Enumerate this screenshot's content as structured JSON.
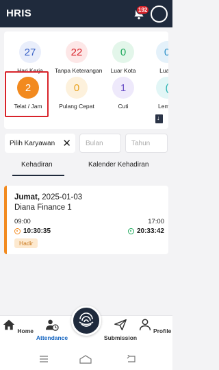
{
  "appbar": {
    "title": "HRIS",
    "notification_count": "192"
  },
  "stats": [
    {
      "value": "27",
      "label": "Hari Kerja",
      "color": "#3a63c7",
      "bg": "#e9eefb"
    },
    {
      "value": "22",
      "label": "Tanpa Keterangan",
      "color": "#d8232a",
      "bg": "#fde7e7"
    },
    {
      "value": "0",
      "label": "Luar Kota",
      "color": "#1ea95c",
      "bg": "#e3f6ea"
    },
    {
      "value": "0",
      "label": "Luar I",
      "color": "#2a8fc7",
      "bg": "#e4f1fa"
    },
    {
      "value": "2",
      "label": "Telat / Jam",
      "color": "#ffffff",
      "bg": "#f28a1f"
    },
    {
      "value": "0",
      "label": "Pulang Cepat",
      "color": "#e8a21f",
      "bg": "#fdf1dc"
    },
    {
      "value": "1",
      "label": "Cuti",
      "color": "#6a4fc7",
      "bg": "#eee9fb"
    },
    {
      "value": "(",
      "label": "Lembu",
      "color": "#2ab0b0",
      "bg": "#e2f6f6"
    }
  ],
  "filters": {
    "employee": "Pilih Karyawan",
    "month_placeholder": "Bulan",
    "year_placeholder": "Tahun"
  },
  "tabs": [
    {
      "label": "Kehadiran",
      "active": true
    },
    {
      "label": "Kalender Kehadiran",
      "active": false
    }
  ],
  "attendance": {
    "day": "Jumat,",
    "date": "2025-01-03",
    "name": "Diana Finance 1",
    "schedule_start": "09:00",
    "schedule_end": "17:00",
    "check_in": "10:30:35",
    "check_out": "20:33:42",
    "status": "Hadir"
  },
  "nav": [
    {
      "label": "Home",
      "icon": "home-icon"
    },
    {
      "label": "Attendance",
      "icon": "attendance-icon",
      "active": true
    },
    {
      "label": "Submission",
      "icon": "send-icon"
    },
    {
      "label": "Profile",
      "icon": "profile-icon"
    }
  ],
  "colors": {
    "primary": "#1f2a3c",
    "accent": "#f28a1f",
    "active_nav": "#1565c0",
    "alert": "#d8232a"
  }
}
